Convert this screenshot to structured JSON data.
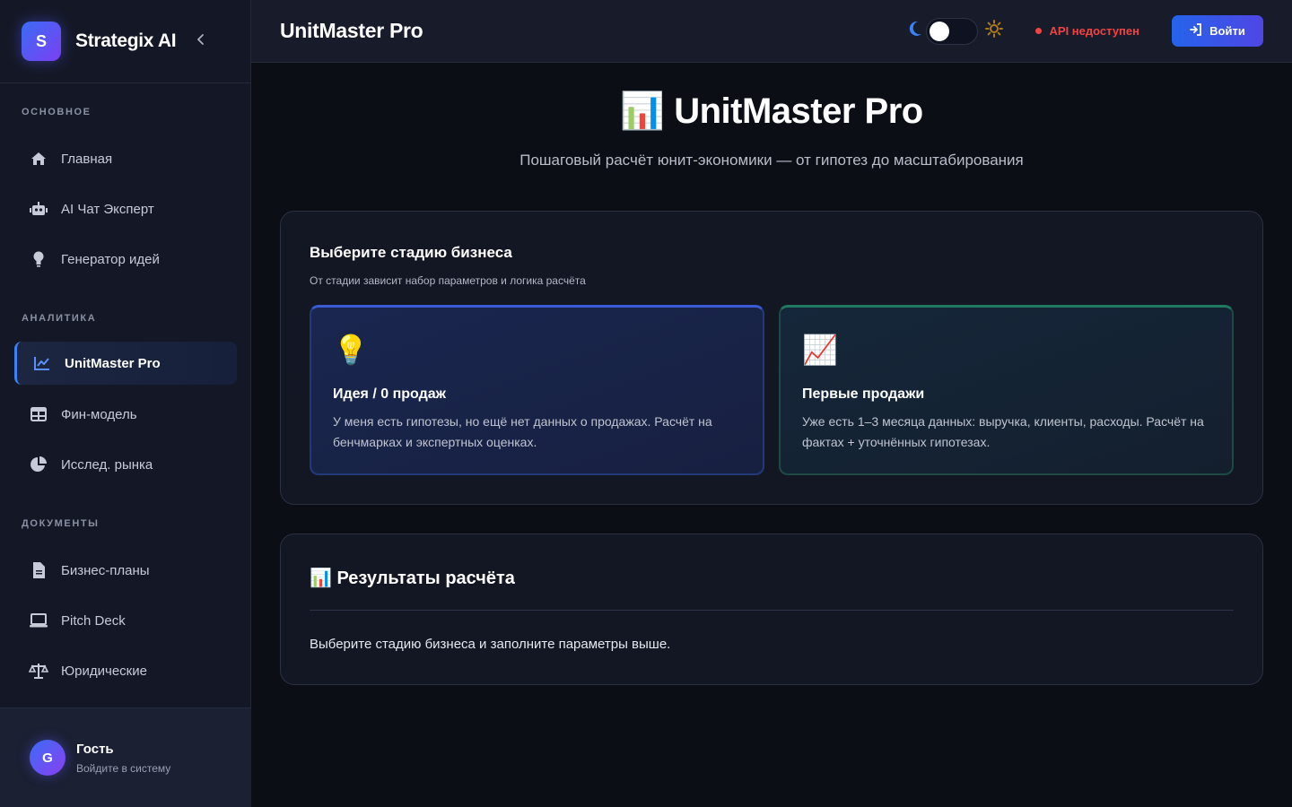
{
  "brand": {
    "logo_letter": "S",
    "name": "Strategix AI",
    "collapse_icon": "chevron-left-icon"
  },
  "sidebar": {
    "sections": [
      {
        "title": "ОСНОВНОЕ",
        "items": [
          {
            "label": "Главная",
            "icon": "home-icon"
          },
          {
            "label": "AI Чат Эксперт",
            "icon": "robot-icon"
          },
          {
            "label": "Генератор идей",
            "icon": "lightbulb-icon"
          }
        ]
      },
      {
        "title": "АНАЛИТИКА",
        "items": [
          {
            "label": "UnitMaster Pro",
            "icon": "chart-line-icon",
            "active": true
          },
          {
            "label": "Фин-модель",
            "icon": "table-icon"
          },
          {
            "label": "Исслед. рынка",
            "icon": "pie-chart-icon"
          }
        ]
      },
      {
        "title": "ДОКУМЕНТЫ",
        "items": [
          {
            "label": "Бизнес-планы",
            "icon": "file-icon"
          },
          {
            "label": "Pitch Deck",
            "icon": "laptop-icon"
          },
          {
            "label": "Юридические",
            "icon": "scales-icon"
          }
        ]
      }
    ]
  },
  "user": {
    "avatar_letter": "G",
    "name": "Гость",
    "subtitle": "Войдите в систему"
  },
  "header": {
    "title": "UnitMaster Pro",
    "api_status": "API недоступен",
    "login_label": "Войти",
    "status_color": "#ef4444",
    "accent_color": "#2563eb"
  },
  "hero": {
    "title": "📊 UnitMaster Pro",
    "subtitle": "Пошаговый расчёт юнит-экономики — от гипотез до масштабирования"
  },
  "stage": {
    "title": "Выберите стадию бизнеса",
    "subtitle": "От стадии зависит набор параметров и логика расчёта",
    "cards": [
      {
        "emoji": "💡",
        "title": "Идея / 0 продаж",
        "desc": "У меня есть гипотезы, но ещё нет данных о продажах. Расчёт на бенчмарках и экспертных оценках."
      },
      {
        "emoji": "📈",
        "title": "Первые продажи",
        "desc": "Уже есть 1–3 месяца данных: выручка, клиенты, расходы. Расчёт на фактах + уточнённых гипотезах."
      }
    ]
  },
  "results": {
    "title": "📊 Результаты расчёта",
    "message": "Выберите стадию бизнеса и заполните параметры выше."
  }
}
